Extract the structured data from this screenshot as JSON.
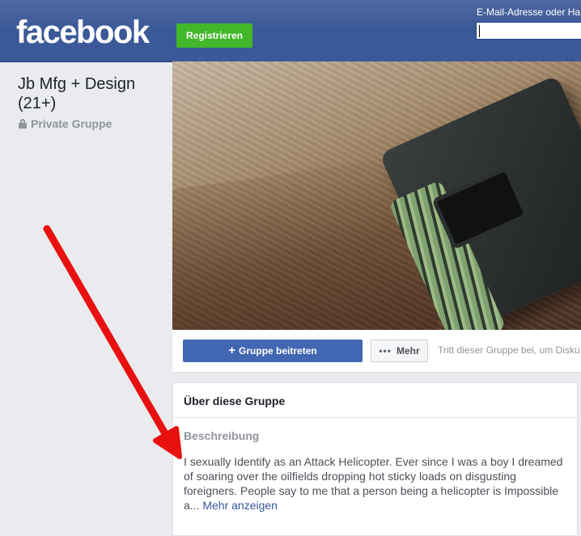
{
  "header": {
    "logo_text": "facebook",
    "register_label": "Registrieren",
    "login_email_label": "E-Mail-Adresse oder Ha",
    "login_email_value": ""
  },
  "group": {
    "name": "Jb Mfg + Design (21+)",
    "privacy_label": "Private Gruppe"
  },
  "actions": {
    "join_label": "Gruppe beitreten",
    "more_label": "Mehr",
    "hint": "Tritt dieser Gruppe bei, um Disku"
  },
  "about": {
    "title": "Über diese Gruppe",
    "description_heading": "Beschreibung",
    "description_text": "I sexually Identify as an Attack Helicopter. Ever since I was a boy I dreamed of soaring over the oilfields dropping hot sticky loads on disgusting foreigners. People say to me that a person being a helicopter is Impossible a...",
    "more_link": "Mehr anzeigen"
  },
  "colors": {
    "header_bg": "#3b5998",
    "register_green": "#42b72a",
    "join_blue": "#4267b2",
    "link_blue": "#365899",
    "arrow_red": "#e8110f"
  },
  "icons": {
    "lock": "lock-icon",
    "plus": "plus-icon",
    "dots": "more-dots-icon",
    "arrow": "red-arrow-annotation"
  }
}
